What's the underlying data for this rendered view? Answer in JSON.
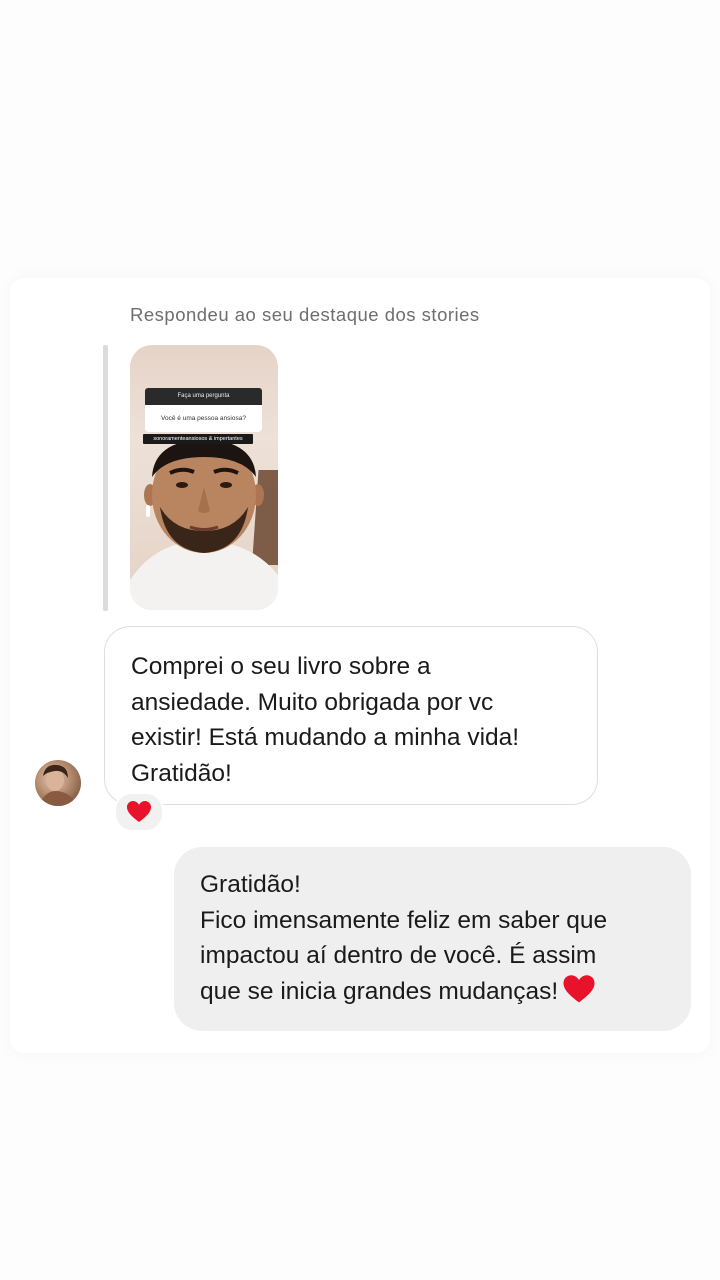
{
  "chat": {
    "reply_note": "Respondeu ao seu destaque dos stories",
    "story": {
      "question_header": "Faça uma pergunta",
      "question_text": "Você é uma pessoa ansiosa?",
      "caption": "sonoramenteansiosos & impertantes"
    },
    "incoming_message": {
      "lines": [
        "Comprei o seu livro sobre a",
        "ansiedade. Muito obrigada por vc",
        "existir! Está mudando a minha vida!",
        "Gratidão!"
      ],
      "reaction_icon": "heart-icon"
    },
    "outgoing_message": {
      "lines": [
        "Gratidão!",
        "Fico imensamente feliz em saber que",
        "impactou aí dentro de você. É assim",
        "que se inicia grandes mudanças!"
      ],
      "emoji_icon": "heart-icon"
    }
  },
  "colors": {
    "page_background": "#fdfdfd",
    "incoming_bubble_border": "#dedede",
    "outgoing_bubble_background": "#efefef",
    "heart": "#e8132b"
  }
}
